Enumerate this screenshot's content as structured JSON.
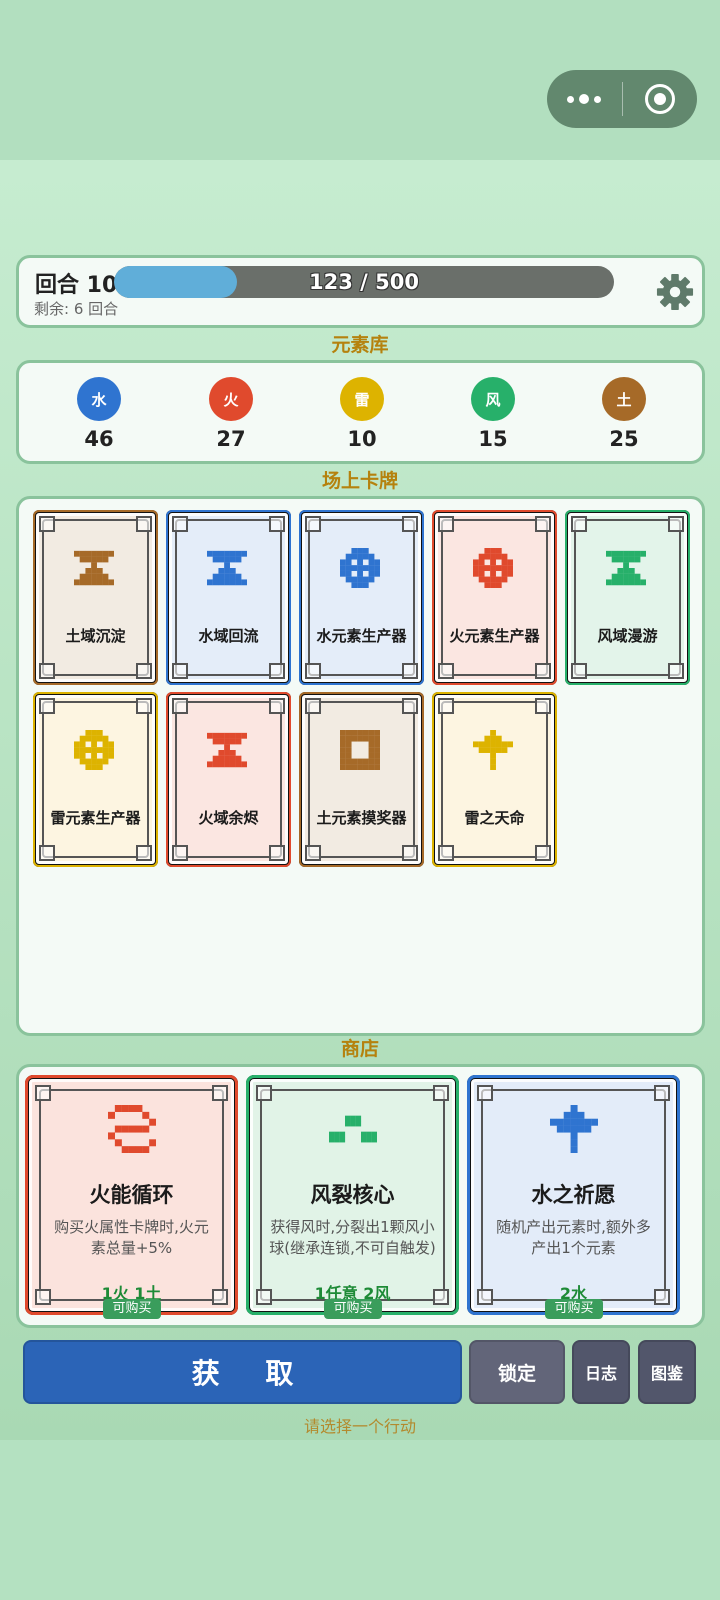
{
  "header": {
    "round_label": "回合 10",
    "remaining_label": "剩余: 6 回合",
    "progress": {
      "text": "123 / 500",
      "current": 123,
      "max": 500
    }
  },
  "pool": {
    "title": "元素库",
    "elements": [
      {
        "label": "水",
        "count": "46",
        "color": "#2f74d0"
      },
      {
        "label": "火",
        "count": "27",
        "color": "#e04a2d"
      },
      {
        "label": "雷",
        "count": "10",
        "color": "#ddb300"
      },
      {
        "label": "风",
        "count": "15",
        "color": "#27b06a"
      },
      {
        "label": "土",
        "count": "25",
        "color": "#a66a28"
      }
    ]
  },
  "field": {
    "title": "场上卡牌",
    "cards": [
      {
        "name": "土域沉淀",
        "element": "土",
        "icon": "hourglass-icon",
        "accent": "#a66a28",
        "bg": "#f2ebe2"
      },
      {
        "name": "水域回流",
        "element": "水",
        "icon": "hourglass-icon",
        "accent": "#2f74d0",
        "bg": "#e4edf9"
      },
      {
        "name": "水元素生产器",
        "element": "水",
        "icon": "generator-icon",
        "accent": "#2f74d0",
        "bg": "#e4edf9"
      },
      {
        "name": "火元素生产器",
        "element": "火",
        "icon": "generator-icon",
        "accent": "#e04a2d",
        "bg": "#fbe6e1"
      },
      {
        "name": "风域漫游",
        "element": "风",
        "icon": "hourglass-icon",
        "accent": "#27b06a",
        "bg": "#e3f4ea"
      },
      {
        "name": "雷元素生产器",
        "element": "雷",
        "icon": "generator-icon",
        "accent": "#ddb300",
        "bg": "#fdf5e1"
      },
      {
        "name": "火域余烬",
        "element": "火",
        "icon": "hourglass-icon",
        "accent": "#e04a2d",
        "bg": "#fbe6e1"
      },
      {
        "name": "土元素摸奖器",
        "element": "土",
        "icon": "frame-icon",
        "accent": "#a66a28",
        "bg": "#f2ebe2"
      },
      {
        "name": "雷之天命",
        "element": "雷",
        "icon": "cross-icon",
        "accent": "#ddb300",
        "bg": "#fdf5e1"
      }
    ]
  },
  "shop": {
    "title": "商店",
    "items": [
      {
        "name": "火能循环",
        "desc": "购买火属性卡牌时,火元素总量+5%",
        "cost": "1火 1土",
        "status": "可购买",
        "icon": "cycle-icon",
        "accent": "#e04a2d",
        "bg": "#fbe3dd"
      },
      {
        "name": "风裂核心",
        "desc": "获得风时,分裂出1颗风小球(继承连锁,不可自触发)",
        "cost": "1任意 2风",
        "status": "可购买",
        "icon": "split-icon",
        "accent": "#27b06a",
        "bg": "#e1f3e7"
      },
      {
        "name": "水之祈愿",
        "desc": "随机产出元素时,额外多产出1个元素",
        "cost": "2水",
        "status": "可购买",
        "icon": "wish-icon",
        "accent": "#2f74d0",
        "bg": "#e3ecf9"
      }
    ]
  },
  "actions": {
    "acquire": "获 取",
    "lock": "锁定",
    "log": "日志",
    "codex": "图鉴",
    "hint": "请选择一个行动"
  }
}
